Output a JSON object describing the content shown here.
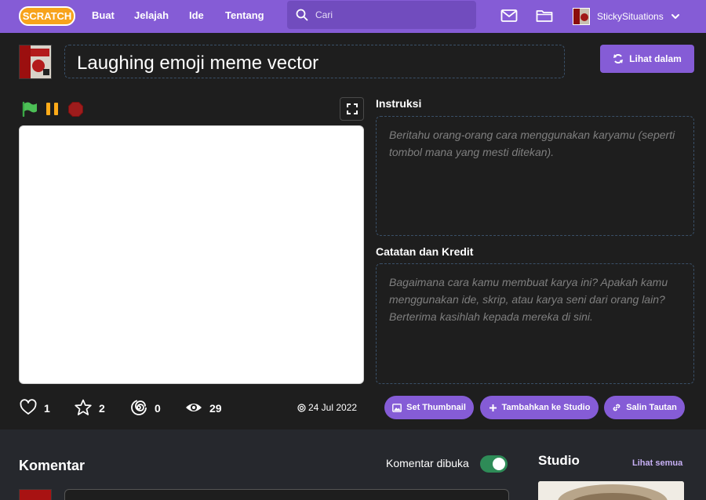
{
  "nav": {
    "logo_text": "SCRATCH",
    "links": [
      "Buat",
      "Jelajah",
      "Ide",
      "Tentang"
    ],
    "search_placeholder": "Cari",
    "username": "StickySituations"
  },
  "project": {
    "title": "Laughing emoji meme vector",
    "see_inside_label": "Lihat dalam"
  },
  "instructions": {
    "label": "Instruksi",
    "placeholder": "Beritahu orang-orang cara menggunakan karyamu (seperti tombol mana yang mesti ditekan)."
  },
  "notes": {
    "label": "Catatan dan Kredit",
    "placeholder": "Bagaimana cara kamu membuat karya ini? Apakah kamu menggunakan ide, skrip, atau karya seni dari orang lain? Berterima kasihlah kepada mereka di sini."
  },
  "stats": {
    "loves": "1",
    "favorites": "2",
    "remixes": "0",
    "views": "29",
    "date": "24 Jul 2022"
  },
  "actions": {
    "set_thumbnail": "Set Thumbnail",
    "add_to_studio": "Tambahkan ke Studio",
    "copy_link": "Salin Tautan"
  },
  "comments": {
    "title": "Komentar",
    "status_label": "Komentar dibuka",
    "enabled": true
  },
  "studios": {
    "title": "Studio",
    "see_all": "Lihat semua"
  },
  "colors": {
    "brand": "#855cd6",
    "background": "#1e1e1e",
    "toggle_on": "#2e8b57"
  }
}
